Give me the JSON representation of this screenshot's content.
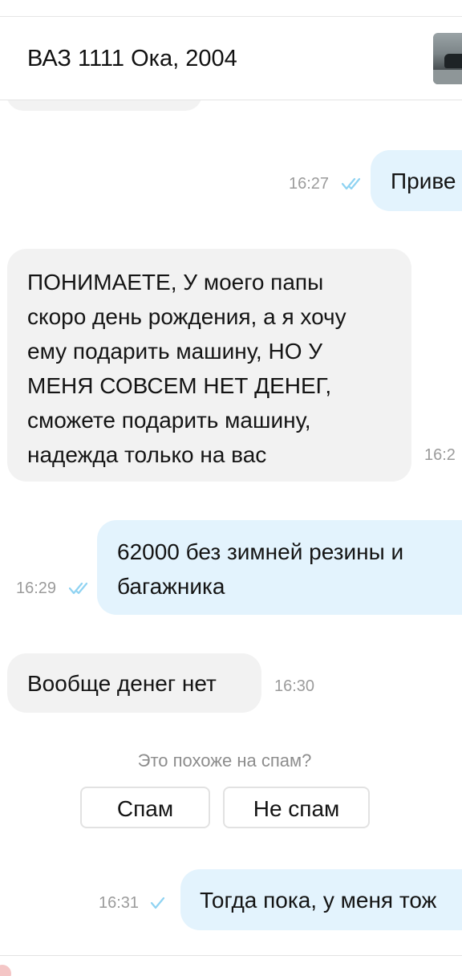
{
  "header": {
    "title": "ВАЗ 1111 Ока, 2004",
    "thumbnail_icon": "car-photo"
  },
  "messages": [
    {
      "direction": "out",
      "text_lines": [
        "Приве"
      ],
      "time": "16:27",
      "status": "read"
    },
    {
      "direction": "in",
      "text_lines": [
        "ПОНИМАЕТЕ, У моего папы",
        "скоро день рождения, а я хочу",
        "ему подарить машину, НО У",
        "МЕНЯ СОВСЕМ НЕТ ДЕНЕГ,",
        "сможете подарить машину,",
        "надежда только на вас"
      ],
      "time": "16:2"
    },
    {
      "direction": "out",
      "text_lines": [
        "62000 без зимней резины и",
        "багажника"
      ],
      "time": "16:29",
      "status": "read"
    },
    {
      "direction": "in",
      "text_lines": [
        "Вообще денег нет"
      ],
      "time": "16:30"
    },
    {
      "direction": "out",
      "text_lines": [
        "Тогда пока, у меня тож"
      ],
      "time": "16:31",
      "status": "sent"
    }
  ],
  "spam_prompt": {
    "question": "Это похоже на спам?",
    "spam_label": "Спам",
    "not_spam_label": "Не спам"
  },
  "colors": {
    "incoming_bubble": "#f2f2f2",
    "outgoing_bubble": "#e3f3fd",
    "read_check": "#8fd3f2",
    "timestamp": "#9b9b9b"
  }
}
